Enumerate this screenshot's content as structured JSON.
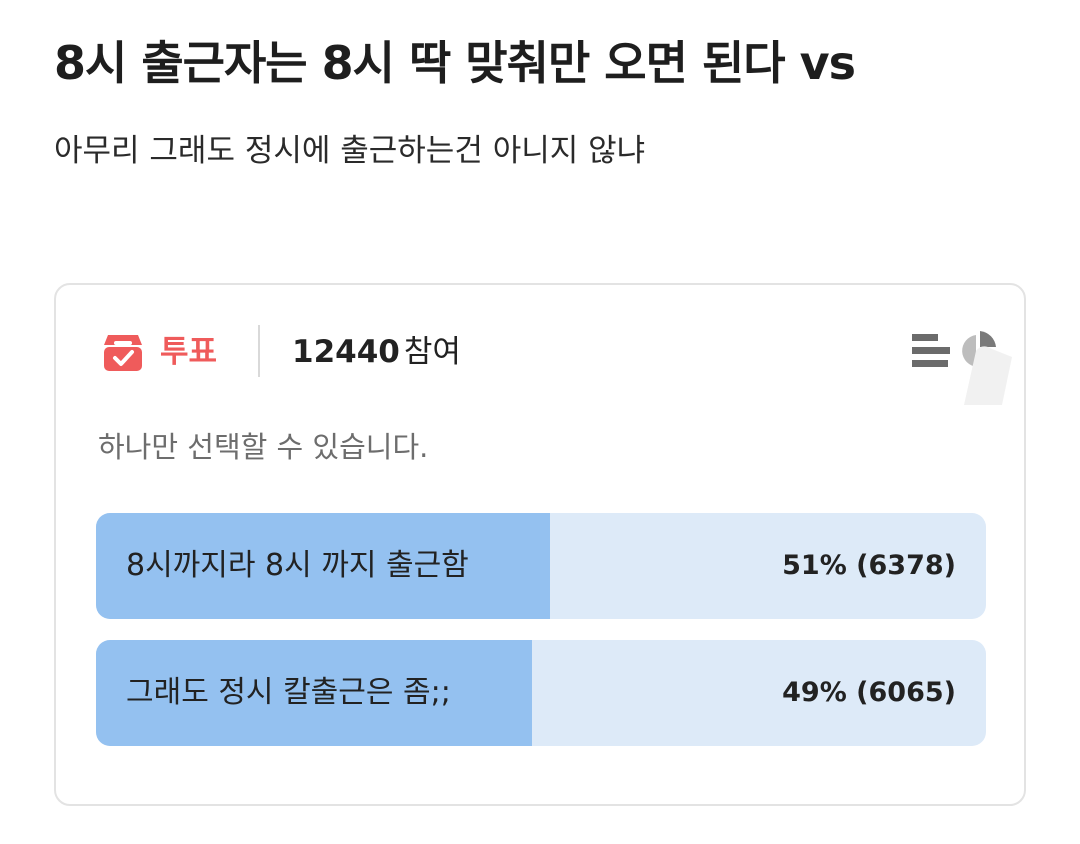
{
  "post": {
    "title": "8시 출근자는 8시 딱 맞춰만 오면 된다 vs",
    "body": "아무리 그래도 정시에 출근하는건 아니지 않냐"
  },
  "poll": {
    "label": "투표",
    "participant_count": "12440",
    "participant_suffix": "참여",
    "hint": "하나만 선택할 수 있습니다.",
    "options": [
      {
        "text": "8시까지라 8시 까지 출근함",
        "result": "51% (6378)",
        "share": 0.51
      },
      {
        "text": "그래도 정시 칼출근은 좀;;",
        "result": "49% (6065)",
        "share": 0.49
      }
    ]
  },
  "icons": {
    "vote": "ballot-box-icon",
    "list_view": "bar-list-icon",
    "pie_view": "pie-chart-icon"
  },
  "colors": {
    "accent": "#ef5b5b",
    "option_fill": "#94c1f0",
    "option_track": "#ddeaf8"
  }
}
